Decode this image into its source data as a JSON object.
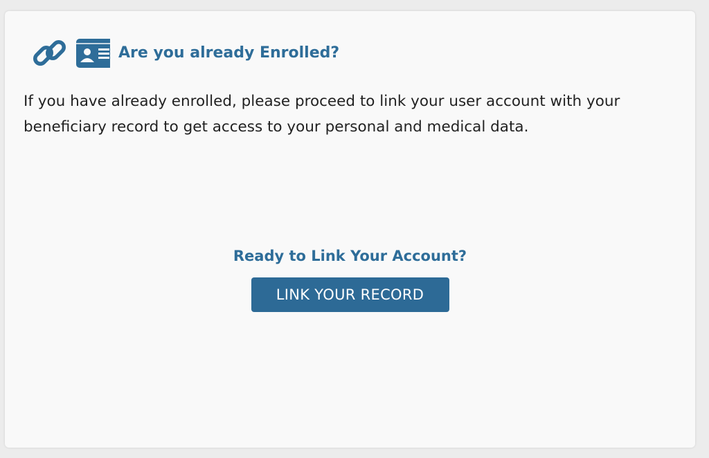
{
  "header": {
    "icon": "link-id-card-icon",
    "title": "Are you already Enrolled?"
  },
  "description": "If you have already enrolled, please proceed to link your user account with your beneficiary record to get access to your personal and medical data.",
  "cta": {
    "heading": "Ready to Link Your Account?",
    "button_label": "LINK YOUR RECORD"
  },
  "colors": {
    "accent": "#2e6d99",
    "button": "#2d6a96",
    "card_background": "#f9f9f9"
  }
}
